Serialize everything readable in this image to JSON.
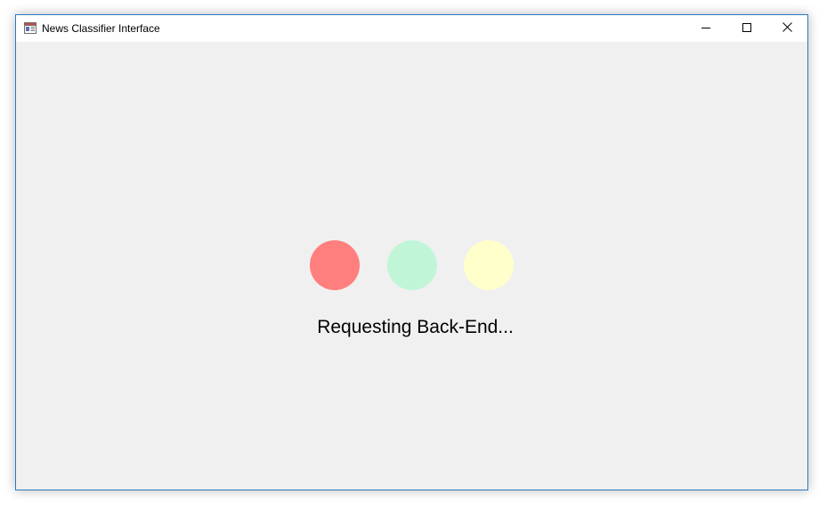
{
  "window": {
    "title": "News Classifier Interface",
    "icon": "app-window-icon",
    "controls": {
      "minimize_icon": "minimize-icon",
      "maximize_icon": "maximize-icon",
      "close_icon": "close-icon"
    }
  },
  "loading": {
    "status_text": "Requesting Back-End...",
    "dots": [
      {
        "name": "red",
        "color": "#ff7f7f"
      },
      {
        "name": "green",
        "color": "#c1f5d7"
      },
      {
        "name": "yellow",
        "color": "#ffffcc"
      }
    ]
  },
  "colors": {
    "window_border": "#2b79c2",
    "client_background": "#f0f0f0",
    "titlebar_background": "#ffffff"
  }
}
